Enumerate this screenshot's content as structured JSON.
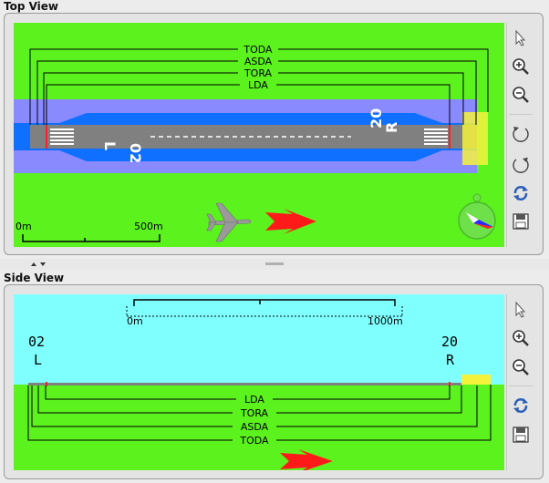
{
  "top_view": {
    "title": "Top View",
    "distances": [
      "TODA",
      "ASDA",
      "TORA",
      "LDA"
    ],
    "runway_left_designator": "02",
    "runway_left_suffix": "L",
    "runway_right_designator": "20",
    "runway_right_suffix": "R",
    "scale_start": "0m",
    "scale_end": "500m"
  },
  "side_view": {
    "title": "Side View",
    "distances": [
      "LDA",
      "TORA",
      "ASDA",
      "TODA"
    ],
    "left_designator": "02",
    "left_suffix": "L",
    "right_designator": "20",
    "right_suffix": "R",
    "scale_start": "0m",
    "scale_end": "1000m"
  },
  "toolbar_top": [
    "pointer-icon",
    "zoom-in-icon",
    "zoom-out-icon",
    "rotate-ccw-icon",
    "rotate-cw-icon",
    "refresh-icon",
    "save-icon"
  ],
  "toolbar_side": [
    "pointer-icon",
    "zoom-in-icon",
    "zoom-out-icon",
    "refresh-icon",
    "save-icon"
  ],
  "colors": {
    "grass": "#5cf21e",
    "sky": "#80ffff",
    "runway": "#808080",
    "blue_safety": "#0f6fff",
    "strip": "#8a8aff",
    "yellow_area": "#f5f23c",
    "arrow": "#ff2020"
  }
}
